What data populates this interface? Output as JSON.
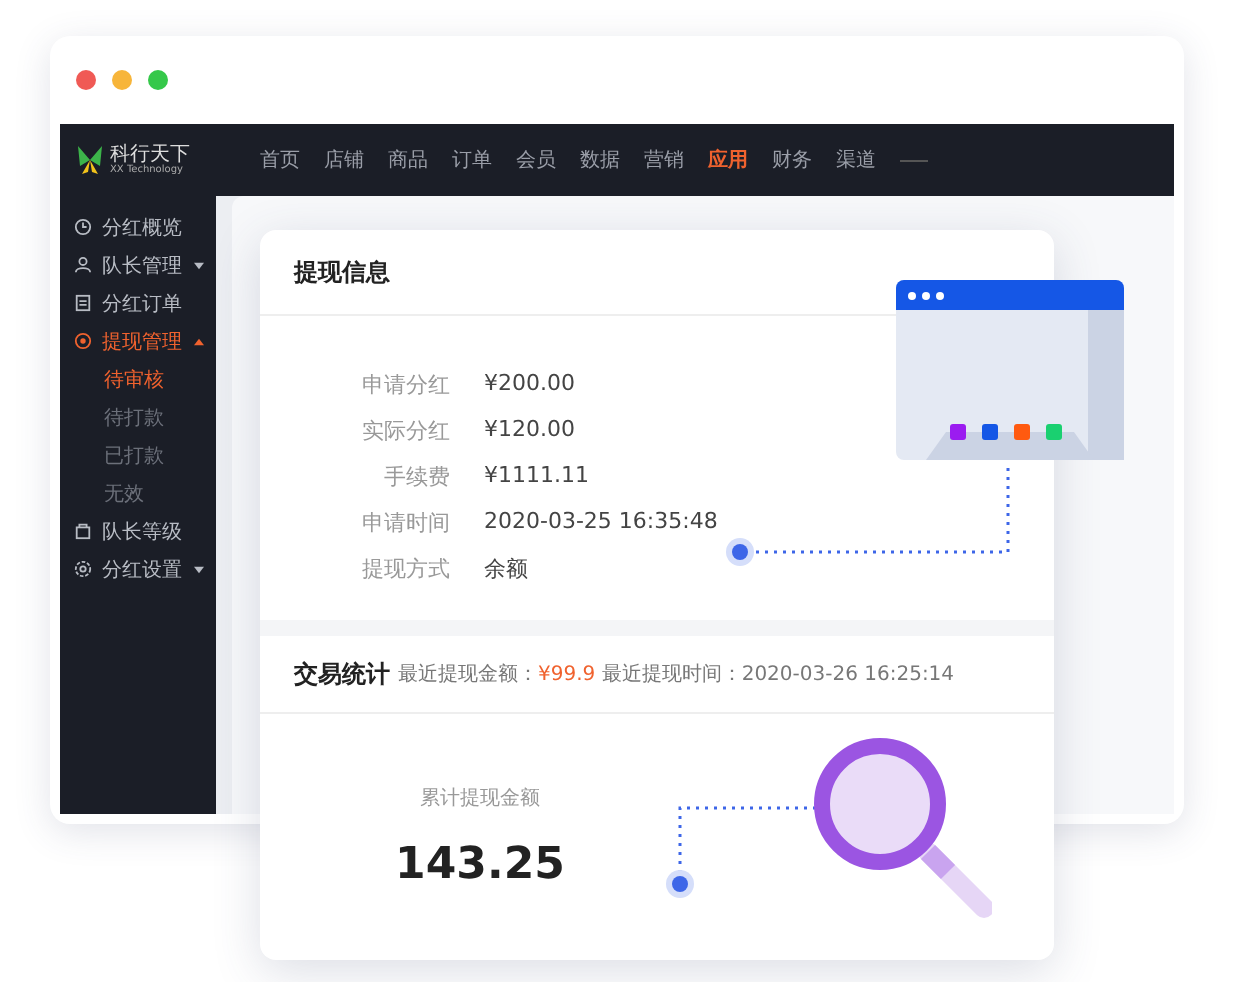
{
  "logo": {
    "name": "科行天下",
    "tagline": "XX Technology"
  },
  "nav": [
    {
      "label": "首页",
      "selected": false
    },
    {
      "label": "店铺",
      "selected": false
    },
    {
      "label": "商品",
      "selected": false
    },
    {
      "label": "订单",
      "selected": false
    },
    {
      "label": "会员",
      "selected": false
    },
    {
      "label": "数据",
      "selected": false
    },
    {
      "label": "营销",
      "selected": false
    },
    {
      "label": "应用",
      "selected": true
    },
    {
      "label": "财务",
      "selected": false
    },
    {
      "label": "渠道",
      "selected": false
    }
  ],
  "sidebar": {
    "items": [
      {
        "label": "分红概览",
        "kind": "link",
        "selected": false
      },
      {
        "label": "队长管理",
        "kind": "group",
        "expanded": false,
        "selected": false
      },
      {
        "label": "分红订单",
        "kind": "link",
        "selected": false
      },
      {
        "label": "提现管理",
        "kind": "group",
        "expanded": true,
        "selected": true,
        "children": [
          {
            "label": "待审核",
            "selected": true
          },
          {
            "label": "待打款",
            "selected": false
          },
          {
            "label": "已打款",
            "selected": false
          },
          {
            "label": "无效",
            "selected": false
          }
        ]
      },
      {
        "label": "队长等级",
        "kind": "link",
        "selected": false
      },
      {
        "label": "分红设置",
        "kind": "group",
        "expanded": false,
        "selected": false
      }
    ]
  },
  "card": {
    "title": "提现信息",
    "fields": [
      {
        "label": "申请分红",
        "value": "¥200.00"
      },
      {
        "label": "实际分红",
        "value": "¥120.00"
      },
      {
        "label": "手续费",
        "value": "¥1111.11"
      },
      {
        "label": "申请时间",
        "value": "2020-03-25 16:35:48"
      },
      {
        "label": "提现方式",
        "value": "余额"
      }
    ],
    "stats": {
      "title": "交易统计",
      "last_amount_label": "最近提现金额：",
      "last_amount": "¥99.9",
      "last_time_label": "最近提现时间：",
      "last_time": "2020-03-26 16:25:14",
      "total_label": "累计提现金额",
      "total": "143.25"
    }
  }
}
